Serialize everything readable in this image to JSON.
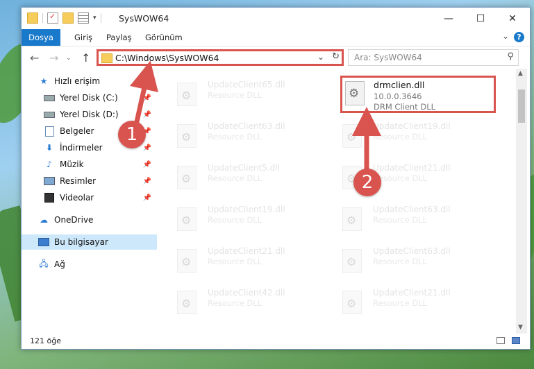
{
  "window": {
    "title": "SysWOW64",
    "minimize_icon": "minimize-icon",
    "maximize_icon": "maximize-icon",
    "close_icon": "close-icon"
  },
  "ribbon": {
    "tabs": [
      "Dosya",
      "Giriş",
      "Paylaş",
      "Görünüm"
    ],
    "help_label": "?"
  },
  "navigation": {
    "address": "C:\\Windows\\SysWOW64",
    "search_placeholder": "Ara: SysWOW64"
  },
  "sidebar": {
    "items": [
      {
        "label": "Hızlı erişim",
        "icon": "star-icon"
      },
      {
        "label": "Yerel Disk (C:)",
        "icon": "drive-icon"
      },
      {
        "label": "Yerel Disk (D:)",
        "icon": "drive-icon"
      },
      {
        "label": "Belgeler",
        "icon": "documents-icon"
      },
      {
        "label": "İndirmeler",
        "icon": "download-icon"
      },
      {
        "label": "Müzik",
        "icon": "music-icon"
      },
      {
        "label": "Resimler",
        "icon": "pictures-icon"
      },
      {
        "label": "Videolar",
        "icon": "video-icon"
      },
      {
        "label": "OneDrive",
        "icon": "cloud-icon"
      },
      {
        "label": "Bu bilgisayar",
        "icon": "computer-icon"
      },
      {
        "label": "Ağ",
        "icon": "network-icon"
      }
    ]
  },
  "files": [
    {
      "name": "UpdateClient65.dll",
      "desc": "Resource DLL"
    },
    {
      "name": "drmclien.dll",
      "version": "10.0.0.3646",
      "desc": "DRM Client DLL"
    },
    {
      "name": "UpdateClient63.dll",
      "desc": "Resource DLL"
    },
    {
      "name": "UpdateClient19.dll",
      "desc": "Resource DLL"
    },
    {
      "name": "UpdateClient5.dll",
      "desc": "Resource DLL"
    },
    {
      "name": "UpdateClient21.dll",
      "desc": "Resource DLL"
    },
    {
      "name": "UpdateClient19.dll",
      "desc": "Resource DLL"
    },
    {
      "name": "UpdateClient63.dll",
      "desc": "Resource DLL"
    },
    {
      "name": "UpdateClient21.dll",
      "desc": "Resource DLL"
    },
    {
      "name": "UpdateClient63.dll",
      "desc": "Resource DLL"
    },
    {
      "name": "UpdateClient42.dll",
      "desc": "Resource DLL"
    },
    {
      "name": "UpdateClient21.dll",
      "desc": "Resource DLL"
    }
  ],
  "status": {
    "item_count": "121 öğe"
  },
  "annotations": {
    "badge_1": "1",
    "badge_2": "2",
    "accent_color": "#d9534f"
  }
}
